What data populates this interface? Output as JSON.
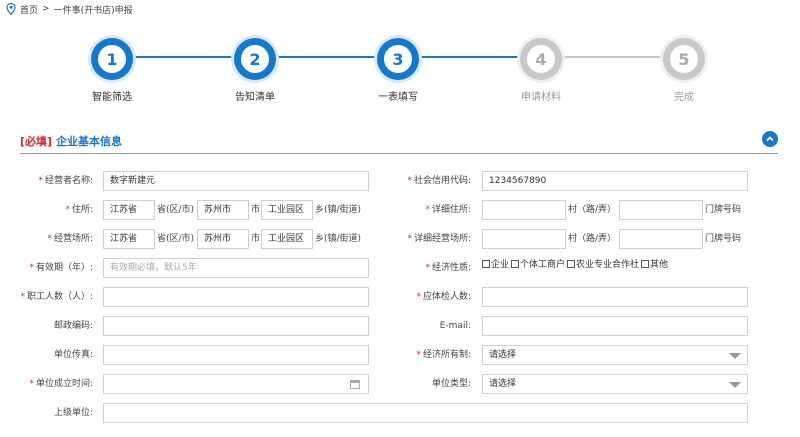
{
  "breadcrumb": {
    "home": "首页",
    "sep": ">",
    "current": "一件事(开书店)申报"
  },
  "steps": [
    {
      "num": "1",
      "label": "智能筛选",
      "state": "active"
    },
    {
      "num": "2",
      "label": "告知清单",
      "state": "active"
    },
    {
      "num": "3",
      "label": "一表填写",
      "state": "active"
    },
    {
      "num": "4",
      "label": "申请材料",
      "state": "inactive"
    },
    {
      "num": "5",
      "label": "完成",
      "state": "inactive"
    }
  ],
  "colors": {
    "accent": "#1677cc",
    "required": "#d9272e",
    "inactive": "#c8c8c8"
  },
  "section": {
    "required_tag": "[必填]",
    "title": "企业基本信息"
  },
  "form": {
    "operator_name": {
      "label": "经营者名称:",
      "value": "数字新建元"
    },
    "credit_code": {
      "label": "社会信用代码:",
      "value": "1234567890"
    },
    "address": {
      "label": "住所:",
      "province": "江苏省",
      "province_unit": "省(区/市)",
      "city": "苏州市",
      "city_unit": "市",
      "district": "工业园区",
      "district_unit": "乡(镇/街道)"
    },
    "detail_address": {
      "label": "详细住所:",
      "village_unit": "村（路/弄）",
      "door_unit": "门牌号码"
    },
    "business_place": {
      "label": "经营场所:",
      "province": "江苏省",
      "province_unit": "省(区/市)",
      "city": "苏州市",
      "city_unit": "市",
      "district": "工业园区",
      "district_unit": "乡(镇/街道)"
    },
    "detail_business_place": {
      "label": "详细经营场所:",
      "village_unit": "村（路/弄）",
      "door_unit": "门牌号码"
    },
    "validity": {
      "label": "有效期（年）:",
      "placeholder": "有效期必填，默认5年"
    },
    "economic_nature": {
      "label": "经济性质:",
      "options": [
        "企业",
        "个体工商户",
        "农业专业合作社",
        "其他"
      ]
    },
    "employees": {
      "label": "职工人数（人）:",
      "value": ""
    },
    "insured_count": {
      "label": "应体检人数:",
      "value": ""
    },
    "postcode": {
      "label": "邮政编码:",
      "value": ""
    },
    "email": {
      "label": "E-mail:",
      "value": ""
    },
    "fax": {
      "label": "单位传真:",
      "value": ""
    },
    "ownership": {
      "label": "经济所有制:",
      "value": "请选择"
    },
    "founded": {
      "label": "单位成立时间:",
      "value": ""
    },
    "unit_type": {
      "label": "单位类型:",
      "value": "请选择"
    },
    "parent": {
      "label": "上级单位:",
      "value": ""
    }
  }
}
